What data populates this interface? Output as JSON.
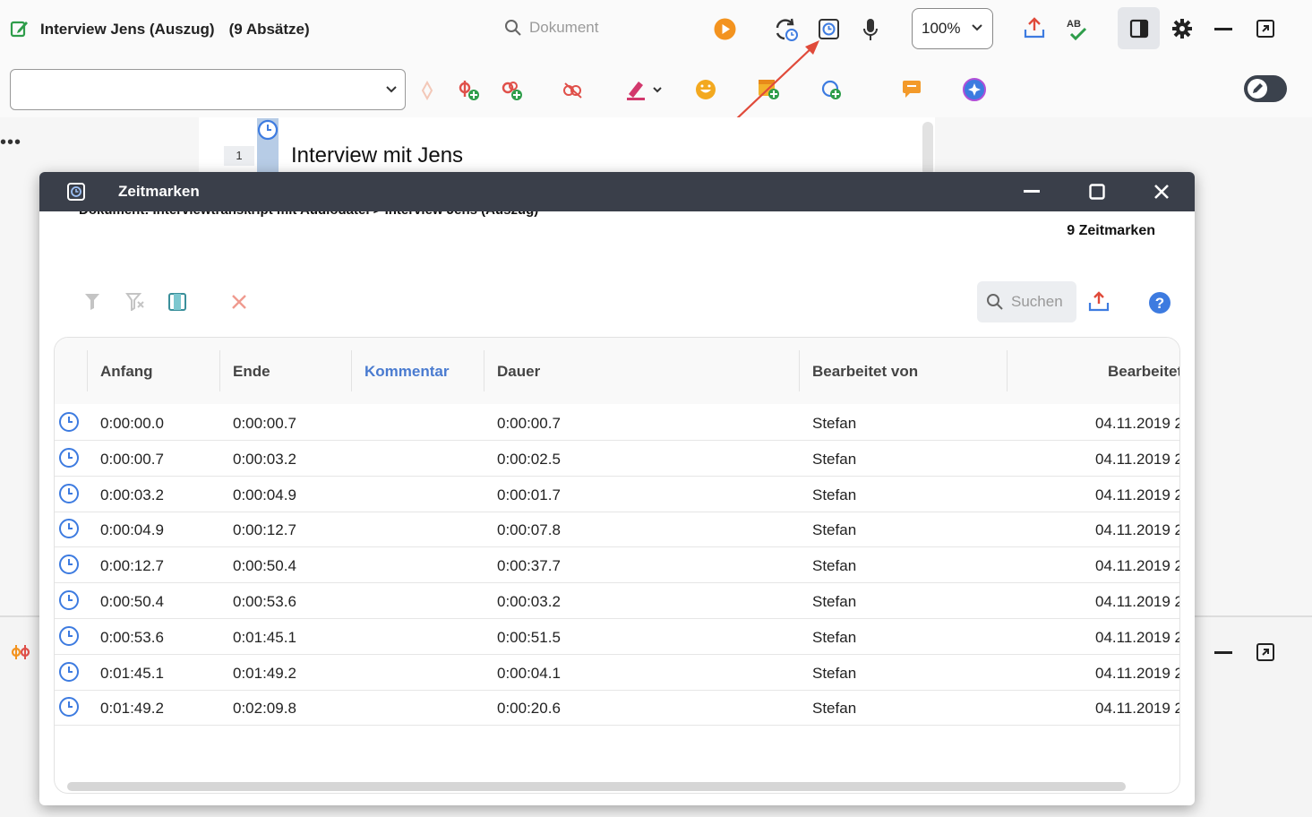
{
  "header": {
    "doc_title": "Interview Jens (Auszug)",
    "doc_count": "(9 Absätze)",
    "search_placeholder": "Dokument",
    "zoom": "100%"
  },
  "document": {
    "paragraph_number": "1",
    "paragraph_text": "Interview mit Jens"
  },
  "dialog": {
    "title": "Zeitmarken",
    "breadcrumb": "Dokument: Interviewtranskript mit Audiodatei > Interview Jens (Auszug)",
    "count": "9 Zeitmarken",
    "search_placeholder": "Suchen",
    "columns": [
      "Anfang",
      "Ende",
      "Kommentar",
      "Dauer",
      "Bearbeitet von",
      "Bearbeitet"
    ],
    "rows": [
      {
        "start": "0:00:00.0",
        "end": "0:00:00.7",
        "comment": "",
        "duration": "0:00:00.7",
        "editor": "Stefan",
        "edited": "04.11.2019 2"
      },
      {
        "start": "0:00:00.7",
        "end": "0:00:03.2",
        "comment": "",
        "duration": "0:00:02.5",
        "editor": "Stefan",
        "edited": "04.11.2019 2"
      },
      {
        "start": "0:00:03.2",
        "end": "0:00:04.9",
        "comment": "",
        "duration": "0:00:01.7",
        "editor": "Stefan",
        "edited": "04.11.2019 2"
      },
      {
        "start": "0:00:04.9",
        "end": "0:00:12.7",
        "comment": "",
        "duration": "0:00:07.8",
        "editor": "Stefan",
        "edited": "04.11.2019 2"
      },
      {
        "start": "0:00:12.7",
        "end": "0:00:50.4",
        "comment": "",
        "duration": "0:00:37.7",
        "editor": "Stefan",
        "edited": "04.11.2019 2"
      },
      {
        "start": "0:00:50.4",
        "end": "0:00:53.6",
        "comment": "",
        "duration": "0:00:03.2",
        "editor": "Stefan",
        "edited": "04.11.2019 2"
      },
      {
        "start": "0:00:53.6",
        "end": "0:01:45.1",
        "comment": "",
        "duration": "0:00:51.5",
        "editor": "Stefan",
        "edited": "04.11.2019 2"
      },
      {
        "start": "0:01:45.1",
        "end": "0:01:49.2",
        "comment": "",
        "duration": "0:00:04.1",
        "editor": "Stefan",
        "edited": "04.11.2019 2"
      },
      {
        "start": "0:01:49.2",
        "end": "0:02:09.8",
        "comment": "",
        "duration": "0:00:20.6",
        "editor": "Stefan",
        "edited": "04.11.2019 2"
      }
    ]
  },
  "colors": {
    "titlebar": "#3a3f4a",
    "accent_blue": "#4a7bd0",
    "clock_blue": "#3d7be0",
    "arrow_red": "#e04a3a",
    "green_check": "#2e9d4a"
  }
}
